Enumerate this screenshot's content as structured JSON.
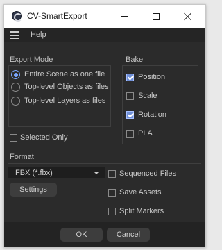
{
  "window": {
    "title": "CV-SmartExport"
  },
  "menubar": {
    "menu_icon": "hamburger-icon",
    "help_label": "Help"
  },
  "export_mode": {
    "title": "Export Mode",
    "options": [
      {
        "label": "Entire Scene as one file",
        "checked": true
      },
      {
        "label": "Top-level Objects as files",
        "checked": false
      },
      {
        "label": "Top-level Layers as files",
        "checked": false
      }
    ]
  },
  "bake": {
    "title": "Bake",
    "options": [
      {
        "label": "Position",
        "checked": true
      },
      {
        "label": "Scale",
        "checked": false
      },
      {
        "label": "Rotation",
        "checked": true
      },
      {
        "label": "PLA",
        "checked": false
      }
    ]
  },
  "selected_only": {
    "label": "Selected Only",
    "checked": false
  },
  "format": {
    "title": "Format",
    "selected": "FBX (*.fbx)",
    "settings_label": "Settings",
    "options": [
      {
        "label": "Sequenced Files",
        "checked": false
      },
      {
        "label": "Save Assets",
        "checked": false
      },
      {
        "label": "Split Markers",
        "checked": false
      }
    ]
  },
  "footer": {
    "ok_label": "OK",
    "cancel_label": "Cancel"
  },
  "colors": {
    "accent": "#7aa5ff",
    "panel_bg": "#2b2b2b",
    "title_bar_bg": "#ffffff"
  }
}
